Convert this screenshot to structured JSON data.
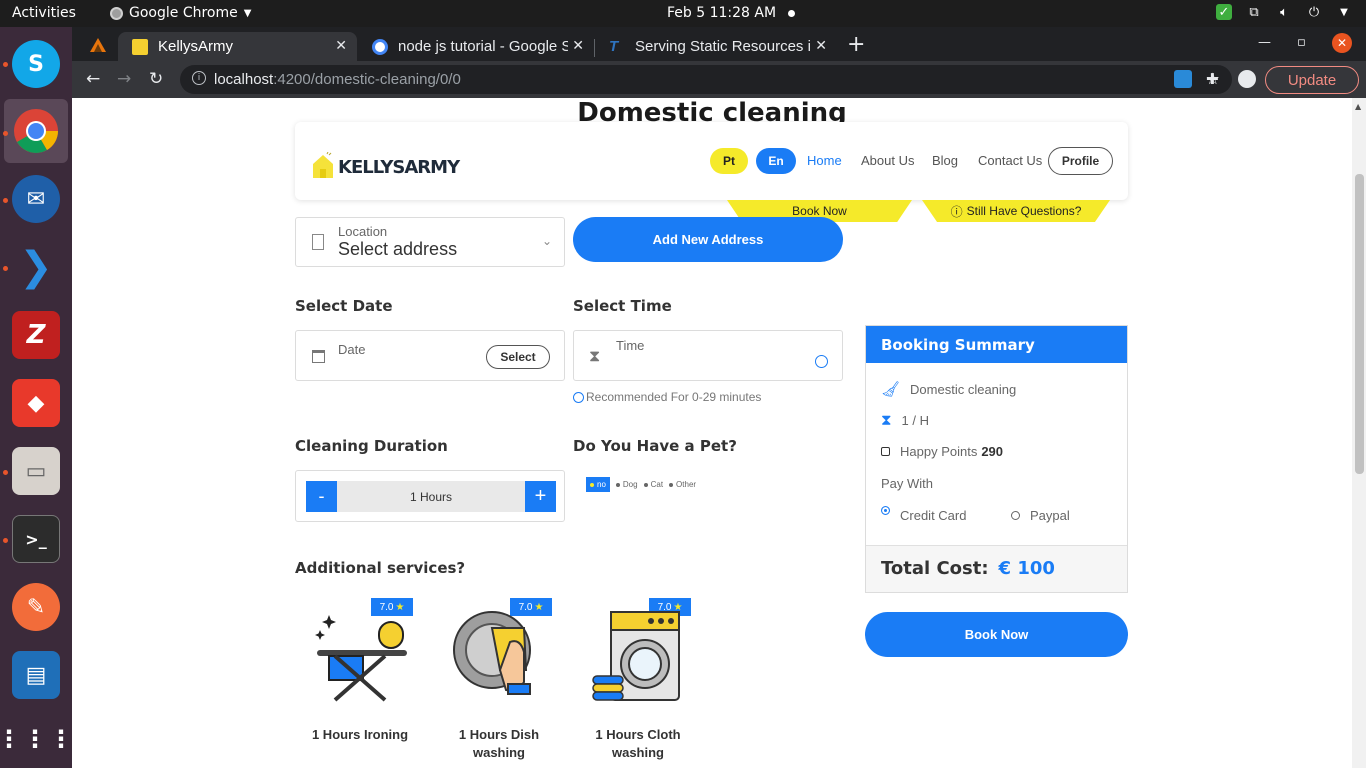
{
  "topbar": {
    "activities": "Activities",
    "app_name": "Google Chrome",
    "clock": "Feb 5  11:28 AM"
  },
  "browser": {
    "tabs": [
      {
        "title": "KellysArmy",
        "active": true
      },
      {
        "title": "node js tutorial - Google S",
        "active": false
      },
      {
        "title": "Serving Static Resources i",
        "active": false
      }
    ],
    "url_host": "localhost",
    "url_rest": ":4200/domestic-cleaning/0/0",
    "update_label": "Update"
  },
  "page": {
    "heading": "Domestic cleaning",
    "header": {
      "logo_text": "KELLYSARMY",
      "lang_pt": "Pt",
      "lang_en": "En",
      "nav": [
        "Home",
        "About Us",
        "Blog",
        "Contact Us"
      ],
      "profile": "Profile",
      "ribbon_book": "Book Now",
      "ribbon_questions": "Still Have Questions?"
    },
    "location": {
      "label": "Location",
      "value": "Select address"
    },
    "add_address": "Add New Address",
    "date": {
      "title": "Select Date",
      "placeholder": "Date",
      "select_btn": "Select"
    },
    "time": {
      "title": "Select Time",
      "placeholder": "Time",
      "hint": "Recommended For 0-29 minutes"
    },
    "duration": {
      "title": "Cleaning Duration",
      "minus": "-",
      "value": "1 Hours",
      "plus": "+"
    },
    "pet": {
      "title": "Do You Have a Pet?",
      "options": [
        "no",
        "Dog",
        "Cat",
        "Other"
      ]
    },
    "additional_title": "Additional services?",
    "services": [
      {
        "name": "1 Hours Ironing",
        "rating": "7.0"
      },
      {
        "name": "1 Hours Dish washing",
        "rating": "7.0"
      },
      {
        "name": "1 Hours Cloth washing",
        "rating": "7.0"
      }
    ],
    "summary": {
      "title": "Booking Summary",
      "service": "Domestic cleaning",
      "duration": "1 / H",
      "happy_label": "Happy Points",
      "happy_value": "290",
      "pay_with": "Pay With",
      "pay_credit": "Credit Card",
      "pay_paypal": "Paypal",
      "total_label": "Total Cost:",
      "total_value": "€ 100"
    },
    "book_now": "Book Now"
  },
  "colors": {
    "primary_blue": "#1a7cf5",
    "accent_yellow": "#f5ea2a",
    "dock": "#3b2a3a"
  }
}
